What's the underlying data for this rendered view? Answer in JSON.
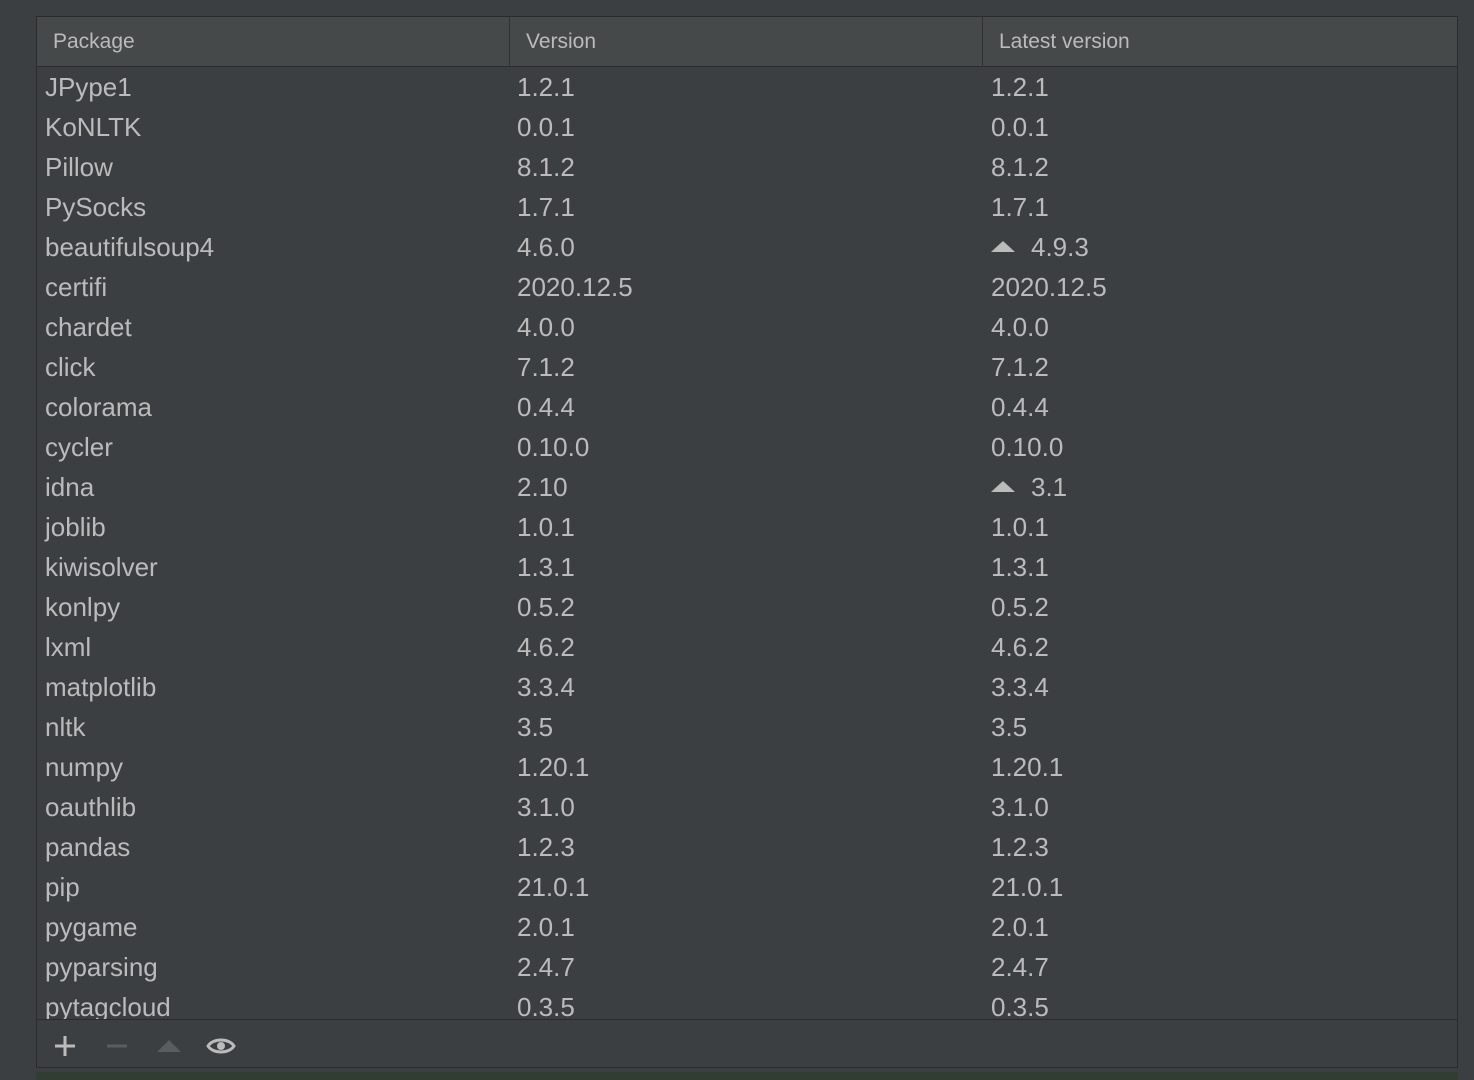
{
  "table": {
    "columns": [
      "Package",
      "Version",
      "Latest version"
    ],
    "rows": [
      {
        "name": "JPype1",
        "version": "1.2.1",
        "latest": "1.2.1",
        "upgrade": false
      },
      {
        "name": "KoNLTK",
        "version": "0.0.1",
        "latest": "0.0.1",
        "upgrade": false
      },
      {
        "name": "Pillow",
        "version": "8.1.2",
        "latest": "8.1.2",
        "upgrade": false
      },
      {
        "name": "PySocks",
        "version": "1.7.1",
        "latest": "1.7.1",
        "upgrade": false
      },
      {
        "name": "beautifulsoup4",
        "version": "4.6.0",
        "latest": "4.9.3",
        "upgrade": true
      },
      {
        "name": "certifi",
        "version": "2020.12.5",
        "latest": "2020.12.5",
        "upgrade": false
      },
      {
        "name": "chardet",
        "version": "4.0.0",
        "latest": "4.0.0",
        "upgrade": false
      },
      {
        "name": "click",
        "version": "7.1.2",
        "latest": "7.1.2",
        "upgrade": false
      },
      {
        "name": "colorama",
        "version": "0.4.4",
        "latest": "0.4.4",
        "upgrade": false
      },
      {
        "name": "cycler",
        "version": "0.10.0",
        "latest": "0.10.0",
        "upgrade": false
      },
      {
        "name": "idna",
        "version": "2.10",
        "latest": "3.1",
        "upgrade": true
      },
      {
        "name": "joblib",
        "version": "1.0.1",
        "latest": "1.0.1",
        "upgrade": false
      },
      {
        "name": "kiwisolver",
        "version": "1.3.1",
        "latest": "1.3.1",
        "upgrade": false
      },
      {
        "name": "konlpy",
        "version": "0.5.2",
        "latest": "0.5.2",
        "upgrade": false
      },
      {
        "name": "lxml",
        "version": "4.6.2",
        "latest": "4.6.2",
        "upgrade": false
      },
      {
        "name": "matplotlib",
        "version": "3.3.4",
        "latest": "3.3.4",
        "upgrade": false
      },
      {
        "name": "nltk",
        "version": "3.5",
        "latest": "3.5",
        "upgrade": false
      },
      {
        "name": "numpy",
        "version": "1.20.1",
        "latest": "1.20.1",
        "upgrade": false
      },
      {
        "name": "oauthlib",
        "version": "3.1.0",
        "latest": "3.1.0",
        "upgrade": false
      },
      {
        "name": "pandas",
        "version": "1.2.3",
        "latest": "1.2.3",
        "upgrade": false
      },
      {
        "name": "pip",
        "version": "21.0.1",
        "latest": "21.0.1",
        "upgrade": false
      },
      {
        "name": "pygame",
        "version": "2.0.1",
        "latest": "2.0.1",
        "upgrade": false
      },
      {
        "name": "pyparsing",
        "version": "2.4.7",
        "latest": "2.4.7",
        "upgrade": false
      },
      {
        "name": "pytagcloud",
        "version": "0.3.5",
        "latest": "0.3.5",
        "upgrade": false
      }
    ]
  },
  "toolbar": {
    "buttons": [
      {
        "icon": "plus-icon",
        "enabled": true
      },
      {
        "icon": "minus-icon",
        "enabled": false
      },
      {
        "icon": "upgrade-arrow-icon",
        "enabled": false
      },
      {
        "icon": "eye-icon",
        "enabled": true
      }
    ]
  },
  "colors": {
    "background": "#3c3f41",
    "header": "#45494a",
    "text": "#bbbbbb",
    "disabled": "#5a5d5f"
  }
}
